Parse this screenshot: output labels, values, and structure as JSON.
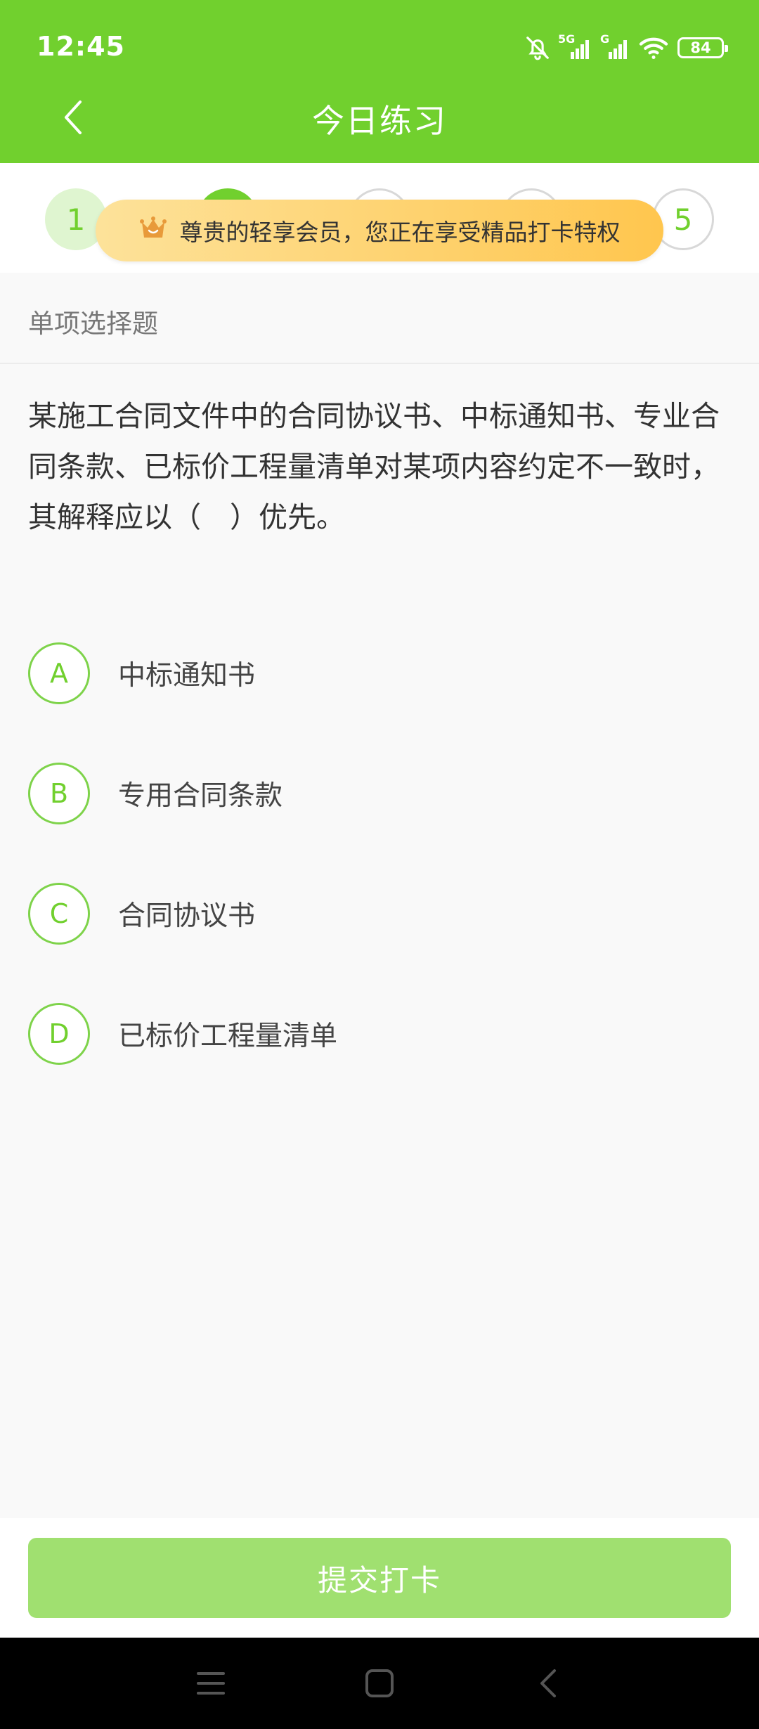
{
  "status_bar": {
    "time": "12:45",
    "network_1": "5G",
    "network_2": "G",
    "battery": "84",
    "icons": [
      "mute-icon",
      "signal-icon",
      "wifi-icon",
      "battery-icon"
    ]
  },
  "header": {
    "title": "今日练习",
    "back_icon": "chevron-left-icon",
    "bg_color": "#71d02e"
  },
  "progress": {
    "steps": [
      {
        "label": "1",
        "state": "visited"
      },
      {
        "label": "",
        "state": "current"
      },
      {
        "label": "",
        "state": "pending"
      },
      {
        "label": "",
        "state": "pending"
      },
      {
        "label": "5",
        "state": "pending"
      }
    ]
  },
  "vip_banner": {
    "icon": "crown-icon",
    "text": "尊贵的轻享会员，您正在享受精品打卡特权"
  },
  "question_type": "单项选择题",
  "question": {
    "text": "某施工合同文件中的合同协议书、中标通知书、专业合同条款、已标价工程量清单对某项内容约定不一致时，其解释应以（　）优先。",
    "options": [
      {
        "letter": "A",
        "text": "中标通知书"
      },
      {
        "letter": "B",
        "text": "专用合同条款"
      },
      {
        "letter": "C",
        "text": "合同协议书"
      },
      {
        "letter": "D",
        "text": "已标价工程量清单"
      }
    ]
  },
  "submit_label": "提交打卡",
  "system_nav": {
    "icons": [
      "menu-icon",
      "home-icon",
      "back-icon"
    ]
  },
  "colors": {
    "accent": "#71d02e",
    "submit_disabled": "#a0e070",
    "banner_start": "#fde29a",
    "banner_end": "#ffc64e"
  }
}
